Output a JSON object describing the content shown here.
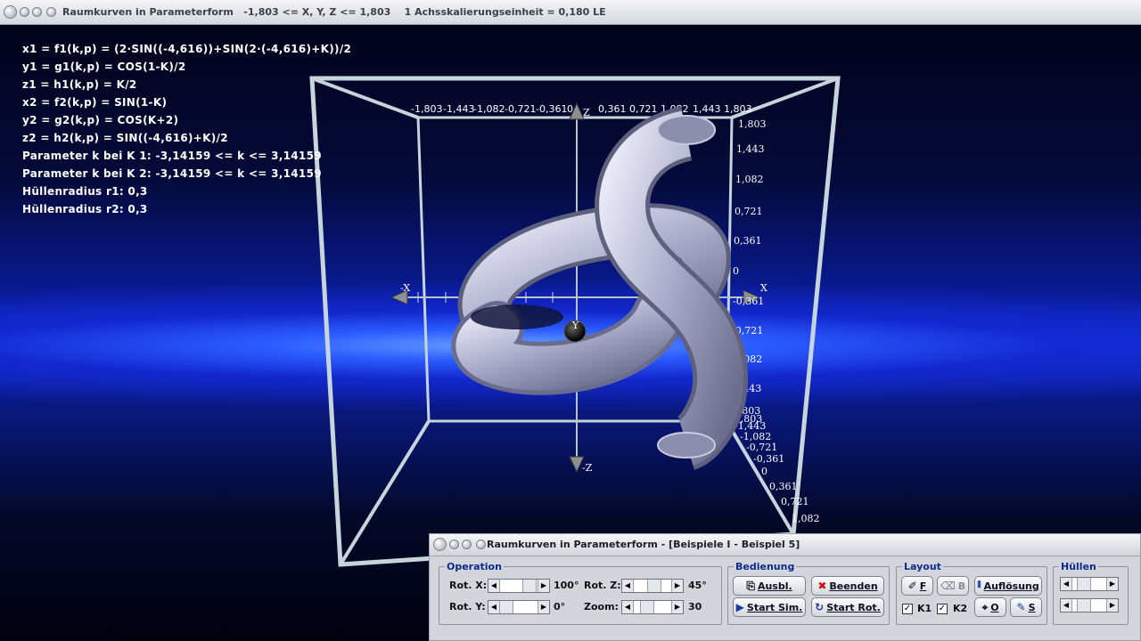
{
  "window": {
    "title": "Raumkurven in Parameterform   -1,803 <= X, Y, Z <= 1,803    1 Achsskalierungseinheit = 0,180 LE"
  },
  "formulas": [
    "x1 = f1(k,p) = (2·SIN((-4,616))+SIN(2·(-4,616)+K))/2",
    "y1 = g1(k,p) = COS(1-K)/2",
    "z1 = h1(k,p) = K/2",
    "x2 = f2(k,p) = SIN(1-K)",
    "y2 = g2(k,p) = COS(K+2)",
    "z2 = h2(k,p) = SIN((-4,616)+K)/2",
    "Parameter k bei K 1: -3,14159 <= k <= 3,14159",
    "Parameter k bei K 2: -3,14159 <= k <= 3,14159",
    "Hüllenradius r1: 0,3",
    "Hüllenradius r2: 0,3"
  ],
  "axes": {
    "x_label": "X",
    "neg_x_label": "-X",
    "z_label": "Z",
    "neg_z_label": "-Z",
    "y_label": "Y",
    "x_ticks": [
      "-1,803",
      "-1,443",
      "-1,082",
      "-0,721",
      "-0,361",
      "0",
      "0,361",
      "0,721",
      "1,082",
      "1,443",
      "1,803"
    ],
    "z_ticks": [
      "1,803",
      "1,443",
      "1,082",
      "0,721",
      "0,361",
      "0",
      "-0,361",
      "-0,721",
      "-1,082",
      "-1,443",
      "-1,803"
    ],
    "y_ticks": [
      "-1,803",
      "-1,443",
      "-1,082",
      "-0,721",
      "-0,361",
      "0",
      "0,361",
      "0,721",
      "1,082"
    ]
  },
  "control_window": {
    "title": "Raumkurven in Parameterform - [Beispiele I - Beispiel 5]",
    "operation": {
      "legend": "Operation",
      "rot_x_label": "Rot. X:",
      "rot_x_value": "100°",
      "rot_y_label": "Rot. Y:",
      "rot_y_value": "0°",
      "rot_z_label": "Rot. Z:",
      "rot_z_value": "45°",
      "zoom_label": "Zoom:",
      "zoom_value": "30"
    },
    "bedienung": {
      "legend": "Bedienung",
      "ausbl": "Ausbl.",
      "beenden": "Beenden",
      "start_sim": "Start Sim.",
      "start_rot": "Start Rot."
    },
    "layout": {
      "legend": "Layout",
      "f": "F",
      "b": "B",
      "aufloesung": "Auflösung",
      "k1": "K1",
      "k2": "K2",
      "o": "O",
      "s": "S"
    },
    "huellen": {
      "legend": "Hüllen"
    }
  },
  "colors": {
    "tube": "#b4b6d2",
    "box": "#c8d8e0",
    "legend_text": "#0c2a8a"
  }
}
